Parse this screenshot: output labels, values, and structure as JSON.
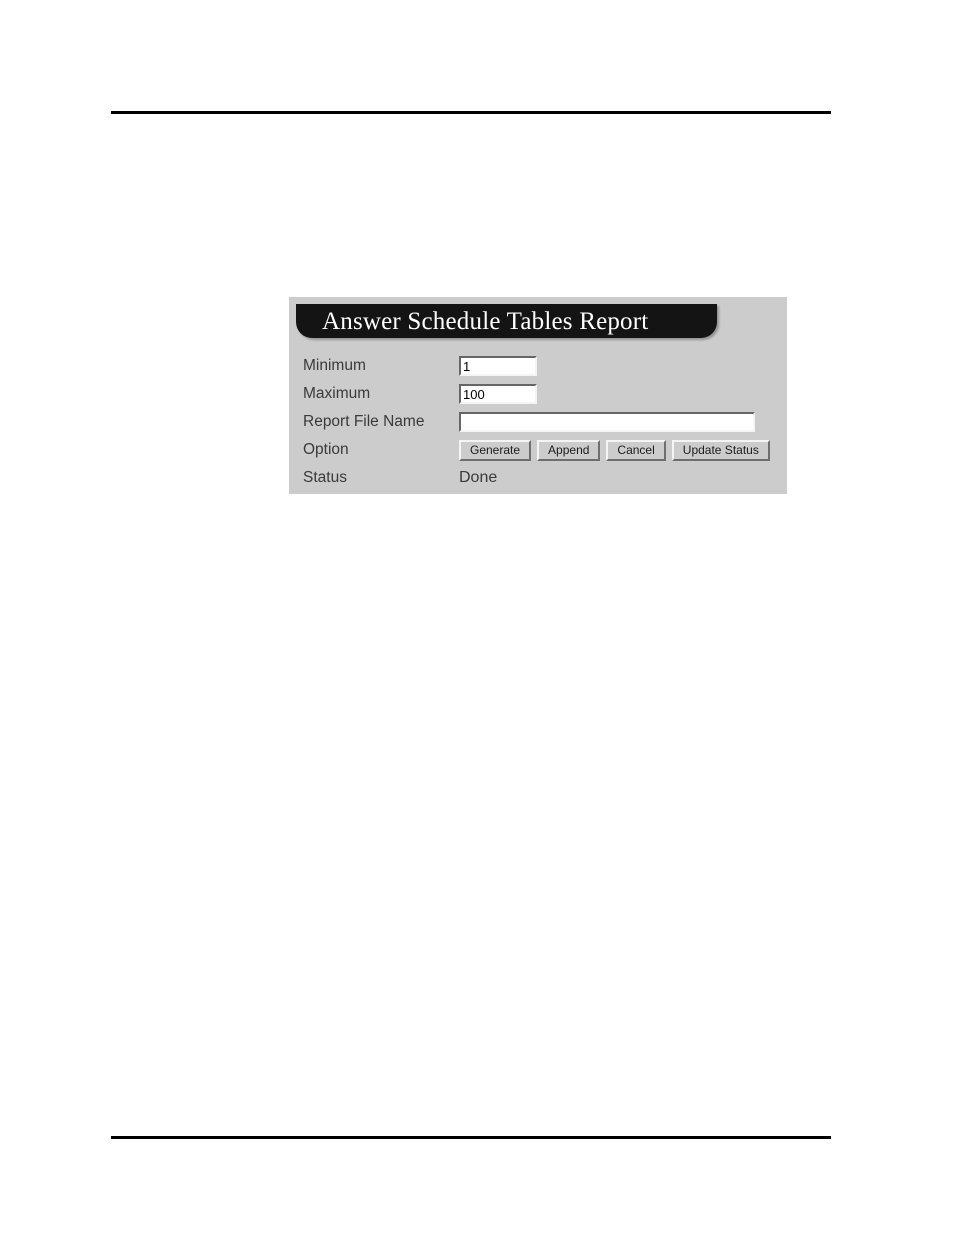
{
  "page": {
    "background_color": "#ffffff",
    "rule_color": "#000000"
  },
  "panel": {
    "background_color": "#cccccc",
    "title": "Answer Schedule Tables Report",
    "title_bar_color": "#141414",
    "title_text_color": "#ffffff",
    "rows": [
      {
        "label": "Minimum"
      },
      {
        "label": "Maximum"
      },
      {
        "label": "Report File Name"
      },
      {
        "label": "Option"
      },
      {
        "label": "Status"
      }
    ],
    "fields": {
      "minimum": {
        "label": "Minimum",
        "value": "1",
        "placeholder": ""
      },
      "maximum": {
        "label": "Maximum",
        "value": "100",
        "placeholder": ""
      },
      "report_file_name": {
        "label": "Report File Name",
        "value": "",
        "placeholder": ""
      }
    },
    "option": {
      "label": "Option",
      "buttons": [
        {
          "label": "Generate"
        },
        {
          "label": "Append"
        },
        {
          "label": "Cancel"
        },
        {
          "label": "Update Status"
        }
      ]
    },
    "status": {
      "label": "Status",
      "value": "Done"
    }
  }
}
